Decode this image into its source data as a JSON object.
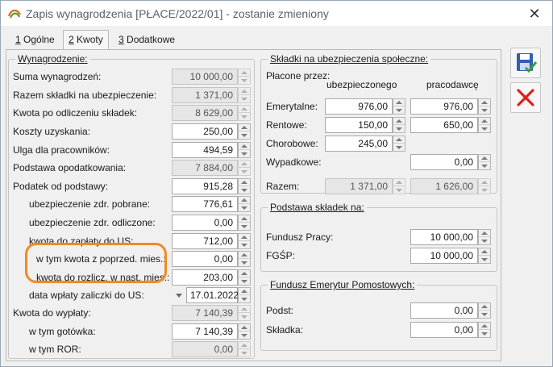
{
  "window": {
    "title": "Zapis wynagrodzenia [PŁACE/2022/01] - zostanie zmieniony",
    "close_glyph": "✕"
  },
  "tabs": [
    {
      "num": "1",
      "label": "Ogólne"
    },
    {
      "num": "2",
      "label": "Kwoty"
    },
    {
      "num": "3",
      "label": "Dodatkowe"
    }
  ],
  "wynagrodzenie": {
    "legend": "Wynagrodzenie:",
    "rows": [
      {
        "label": "Suma wynagrodzeń:",
        "value": "10 000,00"
      },
      {
        "label": "Razem składki na ubezpieczenie:",
        "value": "1 371,00"
      },
      {
        "label": "Kwota po odliczeniu składek:",
        "value": "8 629,00"
      },
      {
        "label": "Koszty uzyskania:",
        "value": "250,00"
      },
      {
        "label": "Ulga dla pracowników:",
        "value": "494,59"
      },
      {
        "label": "Podstawa opodatkowania:",
        "value": "7 884,00"
      },
      {
        "label": "Podatek od podstawy:",
        "value": "915,28"
      },
      {
        "label": "ubezpieczenie zdr. pobrane:",
        "value": "776,61"
      },
      {
        "label": "ubezpieczenie zdr. odliczone:",
        "value": "0,00"
      },
      {
        "label": "kwota do zapłaty do US:",
        "value": "712,00"
      },
      {
        "label": "w tym kwota z poprzed. mies.:",
        "value": "0,00"
      },
      {
        "label": "kwota do rozlicz. w nast. mies.:",
        "value": "203,00"
      },
      {
        "label": "data wpłaty zaliczki do US:",
        "value": "17.01.2022"
      },
      {
        "label": "Kwota do wypłaty:",
        "value": "7 140,39"
      },
      {
        "label": "w tym gotówka:",
        "value": "7 140,39"
      },
      {
        "label": "w tym ROR:",
        "value": "0,00"
      }
    ]
  },
  "skladki": {
    "legend": "Składki na ubezpieczenia społeczne:",
    "payer_label": "Płacone przez:",
    "col_insured": "ubezpieczonego",
    "col_employer": "pracodawcę",
    "rows": [
      {
        "label": "Emerytalne:",
        "insured": "976,00",
        "employer": "976,00"
      },
      {
        "label": "Rentowe:",
        "insured": "150,00",
        "employer": "650,00"
      },
      {
        "label": "Chorobowe:",
        "insured": "245,00",
        "employer": ""
      },
      {
        "label": "Wypadkowe:",
        "insured": "",
        "employer": "0,00"
      }
    ],
    "total": {
      "label": "Razem:",
      "insured": "1 371,00",
      "employer": "1 626,00"
    }
  },
  "podstawa": {
    "legend": "Podstawa składek na:",
    "rows": [
      {
        "label": "Fundusz Pracy:",
        "value": "10 000,00"
      },
      {
        "label": "FGŚP:",
        "value": "10 000,00"
      }
    ]
  },
  "femp": {
    "legend": "Fundusz Emerytur Pomostowych:",
    "rows": [
      {
        "label": "Podst:",
        "value": "0,00"
      },
      {
        "label": "Składka:",
        "value": "0,00"
      }
    ]
  },
  "colors": {
    "highlight": "#f08a24",
    "save_icon": "#2f5fb3",
    "cancel_icon": "#d9221c"
  }
}
